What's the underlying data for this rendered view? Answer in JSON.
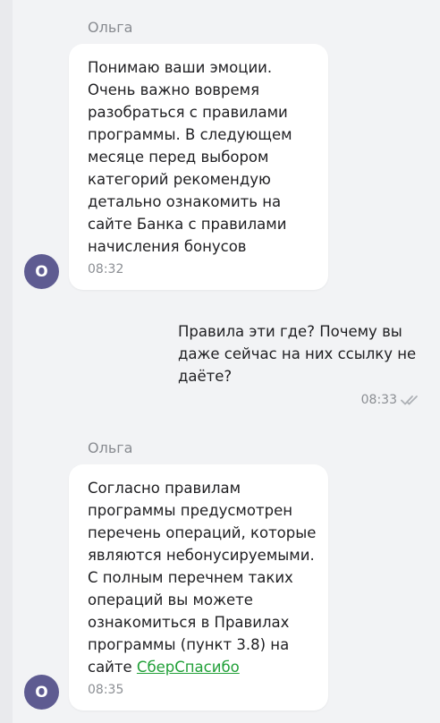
{
  "messages": [
    {
      "sender": "Ольга",
      "avatar_letter": "О",
      "text": "Понимаю ваши эмоции.\nОчень важно вовремя\nразобраться с правилами\nпрограммы. В следующем\nмесяце перед выбором\nкатегорий рекомендую\nдетально ознакомить на\nсайте Банка с правилами\nначисления бонусов",
      "time": "08:32"
    },
    {
      "text": "Правила эти где? Почему вы\nдаже сейчас на них ссылку не\nдаёте?",
      "time": "08:33",
      "status_icon": "double-check-icon"
    },
    {
      "sender": "Ольга",
      "avatar_letter": "О",
      "text": "Согласно правилам\nпрограммы предусмотрен\nперечень операций, которые\nявляются небонусируемыми.\nС полным перечнем таких\nопераций вы можете\nознакомиться в Правилах\nпрограммы (пункт 3.8) на\nсайте ",
      "link_text": "СберСпасибо",
      "time": "08:35"
    }
  ],
  "colors": {
    "background": "#f2f3f5",
    "bubble": "#ffffff",
    "avatar": "#5e5b91",
    "link": "#21a038",
    "secondary_text": "#888b90"
  }
}
